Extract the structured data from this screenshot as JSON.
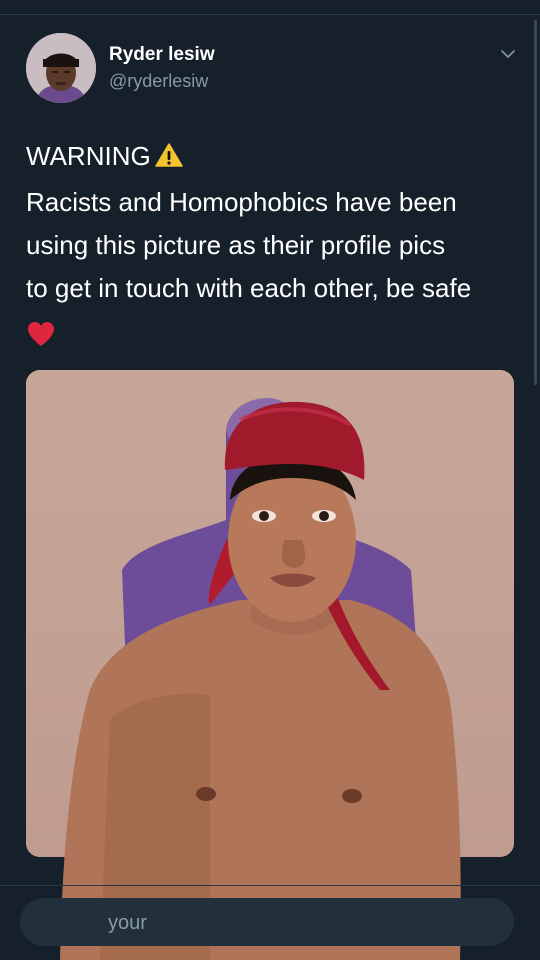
{
  "tweet": {
    "author": {
      "display_name": "Ryder lesiw",
      "handle": "@ryderlesiw",
      "avatar_icon": "avatar-photo"
    },
    "menu_icon": "chevron-down-icon",
    "text_lines": [
      "WARNING",
      "Racists and Homophobics have been",
      "using this picture as their profile pics",
      "to get in touch with each other, be safe"
    ],
    "emoji": {
      "warning": "warning-icon",
      "heart": "red-heart-icon"
    },
    "media": {
      "type": "photo",
      "icon": "photo-image"
    }
  },
  "reply": {
    "placeholder_visible": "your"
  },
  "colors": {
    "background": "#15202b",
    "text_primary": "#ffffff",
    "text_secondary": "#8899a6",
    "divider": "#2a3744",
    "reply_box": "#22303c"
  }
}
